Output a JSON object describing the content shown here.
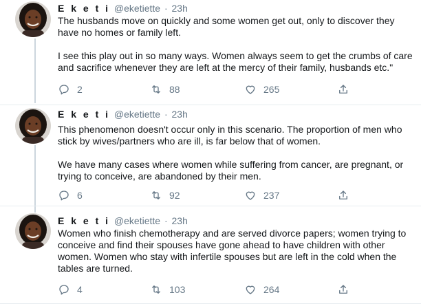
{
  "tweets": [
    {
      "name": "E k e t i",
      "handle": "@eketiette",
      "dot": "·",
      "time": "23h",
      "paragraphs": [
        "The husbands move on quickly and some women get out, only to discover they\nhave no homes or family left.",
        "I see this play out in so many ways. Women always seem to get the crumbs of care\nand sacrifice whenever they are left at the mercy of their family, husbands etc.\""
      ],
      "replies": "2",
      "retweets": "88",
      "likes": "265"
    },
    {
      "name": "E k e t i",
      "handle": "@eketiette",
      "dot": "·",
      "time": "23h",
      "paragraphs": [
        "This phenomenon doesn't occur only in this scenario. The proportion of men who\nstick by wives/partners who are ill, is far below that of women.",
        "We have many cases where women while suffering from cancer, are pregnant, or\ntrying to conceive, are abandoned by their men."
      ],
      "replies": "6",
      "retweets": "92",
      "likes": "237"
    },
    {
      "name": "E k e t i",
      "handle": "@eketiette",
      "dot": "·",
      "time": "23h",
      "paragraphs": [
        "Women who finish chemotherapy and are served divorce papers; women trying to\nconceive and find their spouses have gone ahead to have children with other\nwomen. Women who stay with infertile spouses but are left in the cold when the\ntables are turned."
      ],
      "replies": "4",
      "retweets": "103",
      "likes": "264"
    }
  ],
  "icons": {
    "reply": "reply-icon",
    "retweet": "retweet-icon",
    "like": "heart-icon",
    "share": "share-icon"
  },
  "colors": {
    "text": "#14171a",
    "muted": "#657786",
    "divider": "#e6ecf0",
    "thread": "#ccd6dd"
  }
}
